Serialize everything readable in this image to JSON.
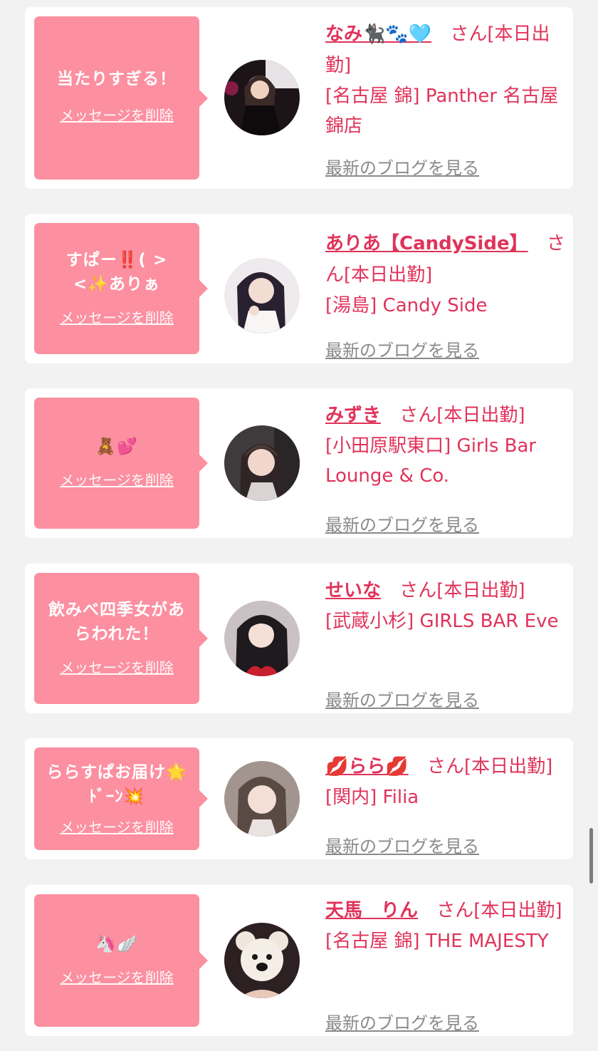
{
  "cards": [
    {
      "message": "当たりすぎる！",
      "delete_label": "メッセージを削除",
      "name": "なみ🐈‍⬛🐾🩵",
      "suffix": "さん[本日出勤]",
      "shop": "[名古屋 錦] Panther 名古屋錦店",
      "blog_label": "最新のブログを見る"
    },
    {
      "message": "すぱー‼️( > <✨ありぁ",
      "delete_label": "メッセージを削除",
      "name": "ありあ【CandySide】",
      "suffix": "さん[本日出勤]",
      "shop": "[湯島] Candy Side",
      "blog_label": "最新のブログを見る"
    },
    {
      "message": "🧸💕",
      "delete_label": "メッセージを削除",
      "name": "みずき",
      "suffix": "さん[本日出勤]",
      "shop": "[小田原駅東口] Girls Bar Lounge & Co.",
      "blog_label": "最新のブログを見る"
    },
    {
      "message": "飲みべ四季女があらわれた！",
      "delete_label": "メッセージを削除",
      "name": "せいな",
      "suffix": "さん[本日出勤]",
      "shop": "[武蔵小杉] GIRLS BAR Eve",
      "blog_label": "最新のブログを見る"
    },
    {
      "message": "ららすぱお届け🌟ﾄﾞｰﾝ💥",
      "delete_label": "メッセージを削除",
      "name": "💋らら💋",
      "suffix": "さん[本日出勤]",
      "shop": "[関内] Filia",
      "blog_label": "最新のブログを見る"
    },
    {
      "message": "🦄🪽",
      "delete_label": "メッセージを削除",
      "name": "天馬　りん",
      "suffix": "さん[本日出勤]",
      "shop": "[名古屋 錦] THE MAJESTY",
      "blog_label": "最新のブログを見る"
    }
  ],
  "colors": {
    "accent": "#e0335a",
    "bubble": "#fc8fa0",
    "card": "#ffffff",
    "page": "#f2f2f2",
    "link_gray": "#8a8a8a"
  },
  "icons": {
    "avatar": "profile-photo"
  }
}
